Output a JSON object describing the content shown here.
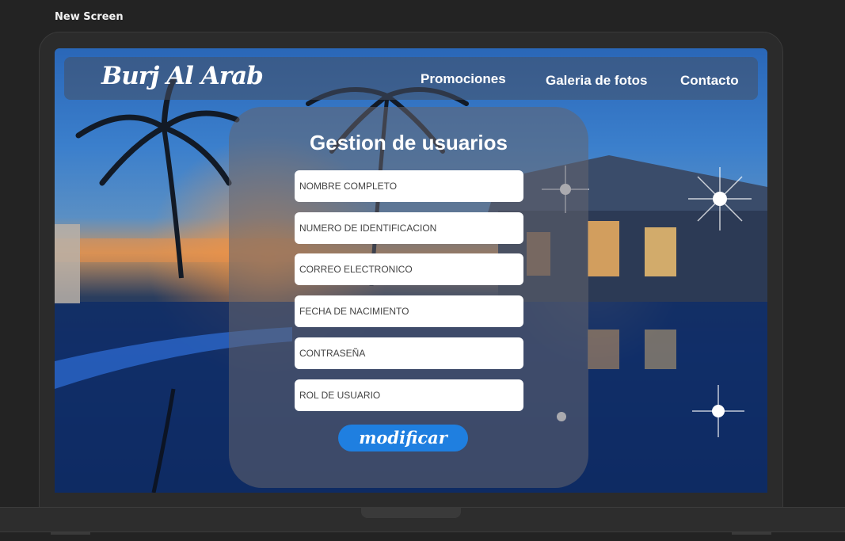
{
  "frame": {
    "label": "New Screen"
  },
  "navbar": {
    "brand": "Burj Al Arab",
    "links": [
      "Promociones",
      "Galeria de fotos",
      "Contacto"
    ]
  },
  "form": {
    "title": "Gestion de usuarios",
    "fields": [
      {
        "placeholder": "NOMBRE COMPLETO"
      },
      {
        "placeholder": "NUMERO DE IDENTIFICACION"
      },
      {
        "placeholder": "CORREO ELECTRONICO"
      },
      {
        "placeholder": "FECHA DE NACIMIENTO"
      },
      {
        "placeholder": "CONTRASEÑA"
      },
      {
        "placeholder": "ROL DE USUARIO"
      }
    ],
    "submit_label": "modificar"
  },
  "colors": {
    "accent_button": "#1f7fe0",
    "background": "#232323",
    "panel": "rgba(100,100,110,0.55)"
  },
  "icons": {
    "background_image": "hotel-pool-night-photo"
  }
}
